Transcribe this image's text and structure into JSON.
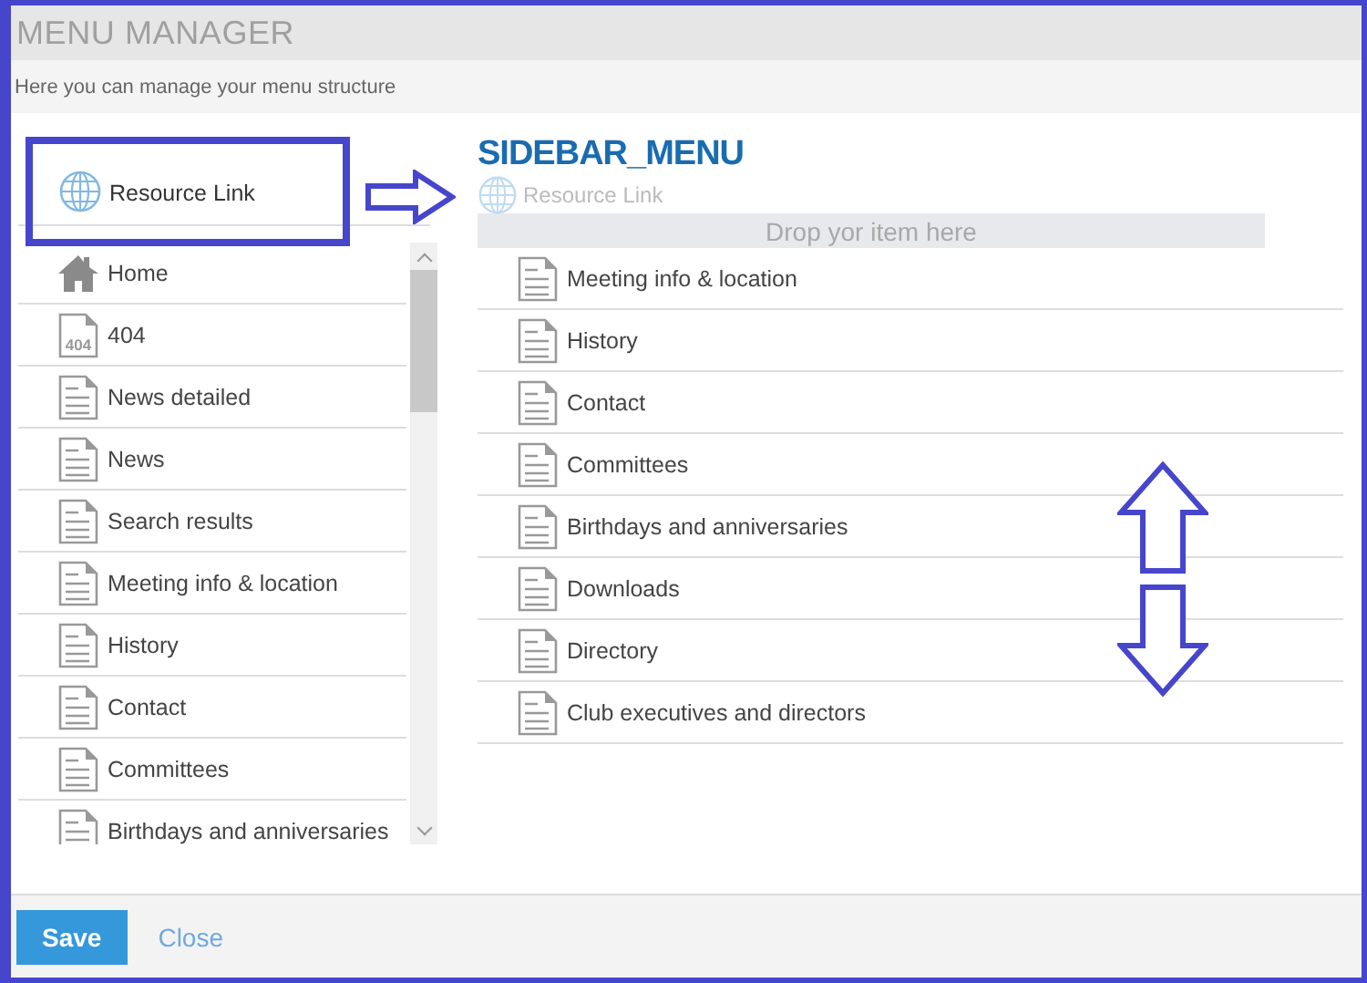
{
  "window": {
    "title": "MENU MANAGER"
  },
  "subtitle": "Here you can manage your menu structure",
  "source": {
    "resource_link": "Resource Link",
    "items": [
      {
        "kind": "home",
        "label": "Home"
      },
      {
        "kind": "error",
        "label": "404",
        "icon_text": "404"
      },
      {
        "kind": "page",
        "label": "News detailed"
      },
      {
        "kind": "page",
        "label": "News"
      },
      {
        "kind": "page",
        "label": "Search results"
      },
      {
        "kind": "page",
        "label": "Meeting info & location"
      },
      {
        "kind": "page",
        "label": "History"
      },
      {
        "kind": "page",
        "label": "Contact"
      },
      {
        "kind": "page",
        "label": "Committees"
      },
      {
        "kind": "page",
        "label": "Birthdays and anniversaries"
      }
    ]
  },
  "target": {
    "title": "SIDEBAR_MENU",
    "dragged_item": "Resource Link",
    "drop_placeholder": "Drop yor item here",
    "items": [
      {
        "kind": "page",
        "label": "Meeting info & location"
      },
      {
        "kind": "page",
        "label": "History"
      },
      {
        "kind": "page",
        "label": "Contact"
      },
      {
        "kind": "page",
        "label": "Committees"
      },
      {
        "kind": "page",
        "label": "Birthdays and anniversaries"
      },
      {
        "kind": "page",
        "label": "Downloads"
      },
      {
        "kind": "page",
        "label": "Directory"
      },
      {
        "kind": "page",
        "label": "Club executives and directors"
      }
    ]
  },
  "annotations": [
    {
      "kind": "frame"
    },
    {
      "kind": "right-arrow"
    },
    {
      "kind": "up-arrow"
    },
    {
      "kind": "down-arrow"
    }
  ],
  "footer": {
    "buttons": [
      {
        "kind": "primary",
        "label": "Save"
      },
      {
        "kind": "link",
        "label": "Close"
      }
    ]
  }
}
